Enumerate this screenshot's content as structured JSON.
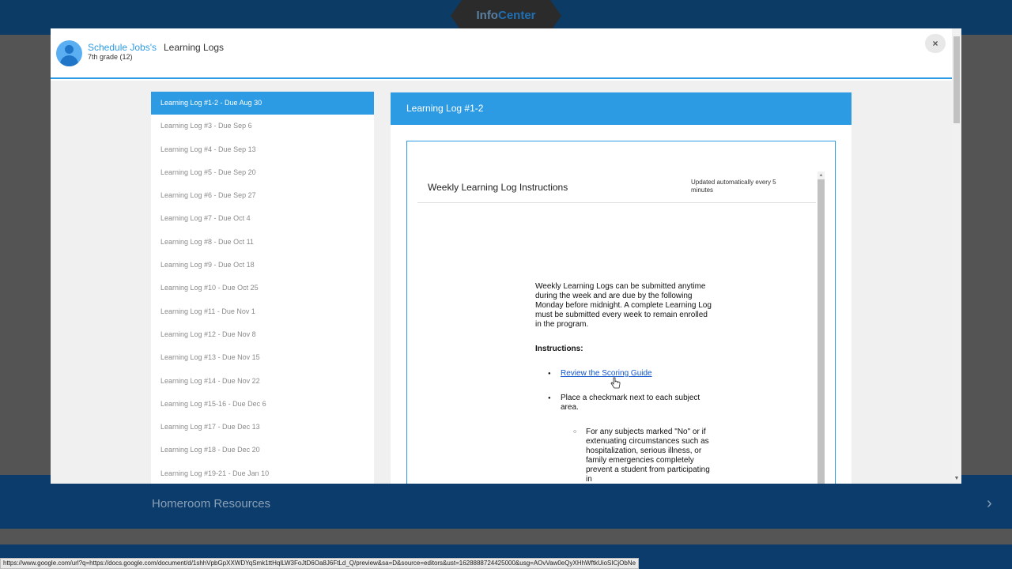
{
  "background": {
    "brand_prefix": "Info",
    "brand_suffix": "Center",
    "homeroom_label": "Homeroom Resources",
    "status_url": "https://www.google.com/url?q=https://docs.google.com/document/d/1shhVpbGpXXWDYqSmk1ttHqlLW3FoJtD6Oa8J6FtLd_Q/preview&sa=D&source=editors&ust=1628888724425000&usg=AOvVaw0eQyXHhWftkUioSICjObNe"
  },
  "modal": {
    "student_name": "Schedule Jobs's",
    "student_grade": "7th grade (12)",
    "title": "Learning Logs",
    "close_label": "×"
  },
  "logs": [
    "Learning Log #1-2 - Due Aug 30",
    "Learning Log #3 - Due Sep 6",
    "Learning Log #4 - Due Sep 13",
    "Learning Log #5 - Due Sep 20",
    "Learning Log #6 - Due Sep 27",
    "Learning Log #7 - Due Oct 4",
    "Learning Log #8 - Due Oct 11",
    "Learning Log #9 - Due Oct 18",
    "Learning Log #10 - Due Oct 25",
    "Learning Log #11 - Due Nov 1",
    "Learning Log #12 - Due Nov 8",
    "Learning Log #13 - Due Nov 15",
    "Learning Log #14 - Due Nov 22",
    "Learning Log #15-16 - Due Dec 6",
    "Learning Log #17 - Due Dec 13",
    "Learning Log #18 - Due Dec 20",
    "Learning Log #19-21 - Due Jan 10"
  ],
  "panel": {
    "header": "Learning Log #1-2",
    "doc_title": "Weekly Learning Log Instructions",
    "doc_updated": "Updated automatically every 5 minutes",
    "intro": "Weekly Learning Logs can be submitted anytime during the week and are due by the following Monday before midnight. A complete Learning Log must be submitted every week to remain enrolled in the program.",
    "instructions_label": "Instructions:",
    "link_text": "Review the Scoring Guide",
    "bullet_2": "Place a checkmark next to each subject area.",
    "sub_bullet": "For any subjects marked \"No\" or if extenuating circumstances such as hospitalization, serious illness, or family emergencies completely prevent a student from participating in"
  },
  "colors": {
    "accent": "#2d9be3",
    "header_bg": "#0c3b66",
    "link": "#1155cc"
  }
}
